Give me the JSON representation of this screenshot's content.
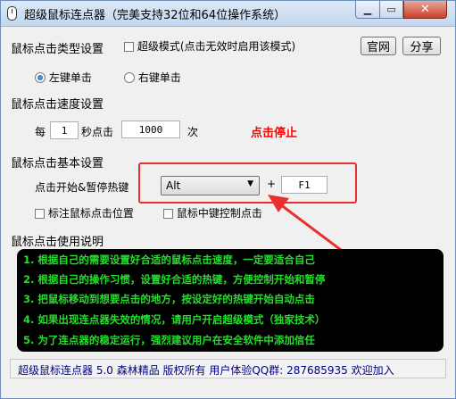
{
  "window": {
    "title": "超级鼠标连点器（完美支持32位和64位操作系统）",
    "min_label": "▁",
    "max_label": "▭",
    "close_label": "✕"
  },
  "click_type": {
    "heading": "鼠标点击类型设置",
    "super_mode_label": "超级模式(点击无效时启用该模式)",
    "super_mode_checked": false,
    "official_label": "官网",
    "share_label": "分享",
    "left_label": "左键单击",
    "right_label": "右键单击",
    "selected": "left"
  },
  "speed": {
    "heading": "鼠标点击速度设置",
    "every_label": "每",
    "seconds_value": "1",
    "seconds_click_label": "秒点击",
    "count_value": "1000",
    "times_label": "次",
    "status_text": "点击停止"
  },
  "basic": {
    "heading": "鼠标点击基本设置",
    "hotkey_label": "点击开始&暂停热键",
    "modifier_value": "Alt",
    "plus_label": "+",
    "key_value": "F1",
    "mark_position_label": "标注鼠标点击位置",
    "middle_control_label": "鼠标中键控制点击"
  },
  "instructions": {
    "heading": "鼠标点击使用说明",
    "lines": [
      "1. 根据自己的需要设置好合适的鼠标点击速度，一定要适合自己",
      "2. 根据自己的操作习惯，设置好合适的热键，方便控制开始和暂停",
      "3. 把鼠标移动到想要点击的地方，按设定好的热键开始自动点击",
      "4. 如果出现连点器失效的情况，请用户开启超级模式（独家技术）",
      "5. 为了连点器的稳定运行，强烈建议用户在安全软件中添加信任"
    ]
  },
  "footer": {
    "text": "超级鼠标连点器 5.0 森林精品 版权所有 用户体验QQ群: 287685935 欢迎加入"
  },
  "colors": {
    "annotation_red": "#e83030",
    "instruction_green": "#22e02a",
    "footer_blue": "#00008a"
  }
}
